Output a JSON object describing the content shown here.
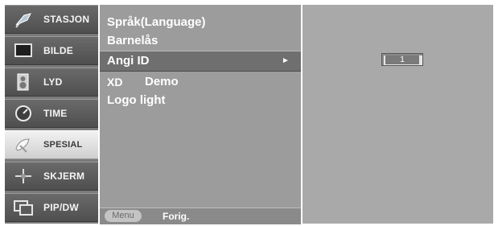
{
  "sidebar": {
    "items": [
      {
        "label": "STASJON",
        "icon": "antenna-icon",
        "active": false
      },
      {
        "label": "BILDE",
        "icon": "tv-screen-icon",
        "active": false
      },
      {
        "label": "LYD",
        "icon": "speaker-icon",
        "active": false
      },
      {
        "label": "TIME",
        "icon": "clock-icon",
        "active": false
      },
      {
        "label": "SPESIAL",
        "icon": "satellite-dish-icon",
        "active": true
      },
      {
        "label": "SKJERM",
        "icon": "screen-adjust-icon",
        "active": false
      },
      {
        "label": "PIP/DW",
        "icon": "pip-icon",
        "active": false
      }
    ]
  },
  "menu": {
    "options": [
      {
        "label": "Språk(Language)"
      },
      {
        "label": "Barnelås"
      },
      {
        "label": "Angi ID",
        "selected": true,
        "arrow": "►"
      },
      {
        "label": "Demo",
        "logo": "XD"
      },
      {
        "label": "Logo light"
      }
    ],
    "footer": {
      "key": "Menu",
      "label": "Forig."
    }
  },
  "preview": {
    "id_value": "1"
  },
  "colors": {
    "active_tab": "#e6e6e6",
    "panel": "#9c9c9c",
    "selected_row": "#6f6f6f"
  }
}
